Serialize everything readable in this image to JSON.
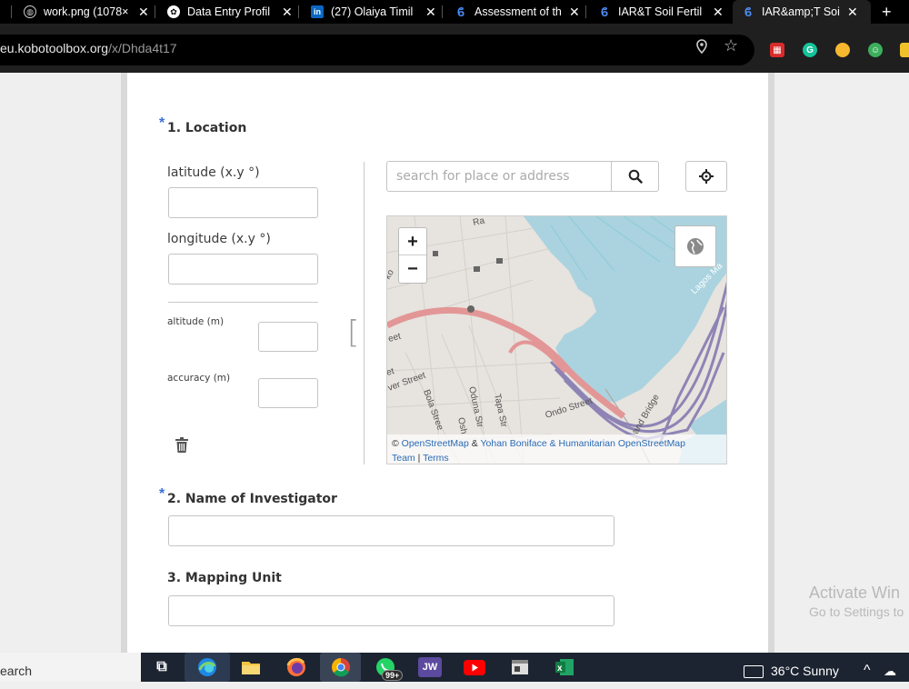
{
  "browser": {
    "tabs": [
      {
        "title": "work.png (1078×",
        "favicon": "globe-icon"
      },
      {
        "title": "Data Entry Profil",
        "favicon": "chatgpt-icon"
      },
      {
        "title": "(27) Olaiya Timil",
        "favicon": "linkedin-icon"
      },
      {
        "title": "Assessment of th",
        "favicon": "kobo-icon"
      },
      {
        "title": "IAR&T Soil Fertil",
        "favicon": "kobo-icon"
      },
      {
        "title": "IAR&amp;T Soil",
        "favicon": "kobo-icon"
      }
    ],
    "close_glyph": "✕",
    "new_tab_glyph": "+",
    "url_host": "eu.kobotoolbox.org",
    "url_path": "/x/Dhda4t17"
  },
  "form": {
    "required_marker": "*",
    "q1": {
      "label": "1. Location",
      "latitude_label": "latitude (x.y °)",
      "longitude_label": "longitude (x.y °)",
      "altitude_label": "altitude (m)",
      "accuracy_label": "accuracy (m)",
      "latitude_value": "",
      "longitude_value": "",
      "altitude_value": "",
      "accuracy_value": "",
      "bracket": "[",
      "search_placeholder": "search for place or address"
    },
    "q2": {
      "label": "2. Name of Investigator",
      "value": ""
    },
    "q3": {
      "label": "3. Mapping Unit",
      "value": ""
    }
  },
  "map": {
    "zoom_in": "+",
    "zoom_out": "−",
    "attribution_prefix": "©",
    "attribution_osm": "OpenStreetMap",
    "attribution_amp": "&",
    "attribution_team": "Yohan Boniface & Humanitarian OpenStreetMap",
    "attribution_team2": "Team",
    "attribution_sep": "|",
    "attribution_terms": "Terms",
    "street_labels": [
      "Ra",
      "ko",
      "eet",
      "et",
      "ver Street",
      "Bola Stree",
      "Oduna Str",
      "Tapa Str",
      "Osh",
      "Ondo Street",
      "and Bridge",
      "Lagos Ma"
    ]
  },
  "watermark": {
    "line1": "Activate Win",
    "line2": "Go to Settings to"
  },
  "taskbar": {
    "search_label": "earch",
    "badge": "99+",
    "jw_label": "JW",
    "weather": "36°C  Sunny",
    "chevron": "^"
  },
  "colors": {
    "accent": "#3a70d8",
    "map_water": "#aad3df",
    "map_road": "#e39696",
    "map_motorway": "#8d84b5"
  }
}
